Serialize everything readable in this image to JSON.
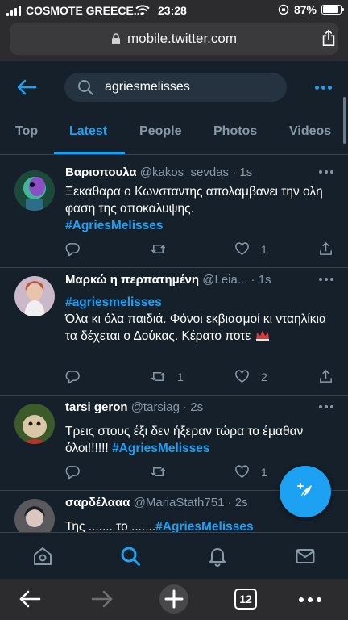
{
  "statusbar": {
    "carrier": "COSMOTE GREECE...",
    "time": "23:28",
    "battery": "87%",
    "battery_level": 0.87
  },
  "browser": {
    "url": "mobile.twitter.com",
    "tab_count": "12"
  },
  "search": {
    "query": "agriesmelisses"
  },
  "tabs": [
    {
      "label": "Top"
    },
    {
      "label": "Latest"
    },
    {
      "label": "People"
    },
    {
      "label": "Photos"
    },
    {
      "label": "Videos"
    }
  ],
  "tweets": [
    {
      "name": "Βαριοπουλα",
      "handle": "@kakos_sevdas",
      "time": "· 1s",
      "text": "Ξεκαθαρα ο Κωνσταντης απολαμβανει την ολη φαση της αποκαλυψης.",
      "hashtag": "#AgriesMelisses",
      "replies": "",
      "retweets": "",
      "likes": "1"
    },
    {
      "name": "Μαρκώ η περπατημένη",
      "handle": "@Leia...",
      "time": "· 1s",
      "hashtag": "#agriesmelisses",
      "text": "Όλα κι όλα παιδιά. Φόνοι εκβιασμοί κι νταηλίκια τα δέχεται ο Δούκας. Κέρατο ποτε",
      "replies": "",
      "retweets": "1",
      "likes": "2"
    },
    {
      "name": "tarsi geron",
      "handle": "@tarsiag",
      "time": "· 2s",
      "text": "Τρεις στους έξι δεν ήξεραν τώρα το έμαθαν όλοι!!!!!!",
      "hashtag": "#AgriesMelisses",
      "replies": "",
      "retweets": "",
      "likes": "1"
    },
    {
      "name": "σαρδέλααα",
      "handle": "@MariaStath751",
      "time": "· 2s",
      "text": "Της ....... το .......",
      "hashtag": "#AgriesMelisses"
    }
  ],
  "colors": {
    "accent": "#1da1f2",
    "background": "#15202b",
    "muted": "#8899a6",
    "divider": "#38444d"
  }
}
